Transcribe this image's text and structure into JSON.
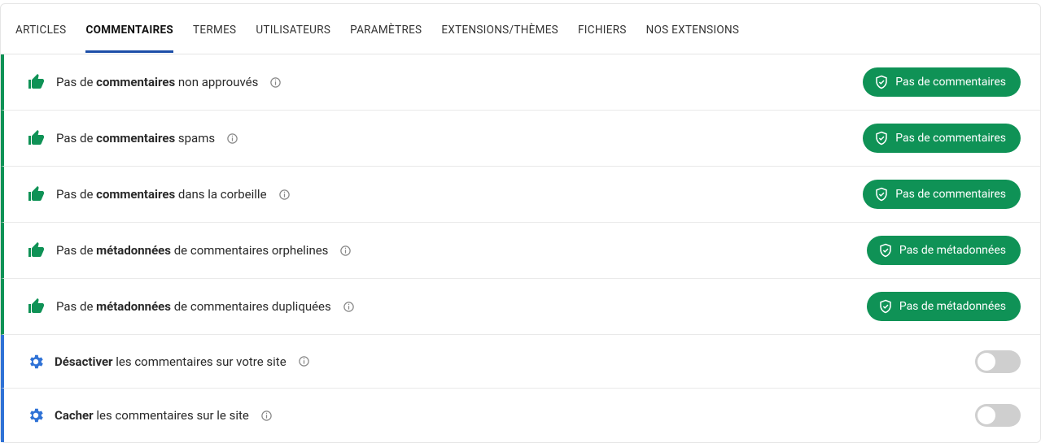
{
  "tabs": {
    "articles": "Articles",
    "commentaires": "Commentaires",
    "termes": "Termes",
    "utilisateurs": "Utilisateurs",
    "parametres": "Paramètres",
    "extensions": "Extensions/Thèmes",
    "fichiers": "Fichiers",
    "nos_extensions": "Nos extensions",
    "active": "commentaires"
  },
  "rows": {
    "unapproved": {
      "pre": "Pas de ",
      "bold": "commentaires",
      "post": " non approuvés"
    },
    "spam": {
      "pre": "Pas de ",
      "bold": "commentaires",
      "post": " spams"
    },
    "trash": {
      "pre": "Pas de ",
      "bold": "commentaires",
      "post": " dans la corbeille"
    },
    "meta_orphan": {
      "pre": "Pas de ",
      "bold": "métadonnées",
      "post": " de commentaires orphelines"
    },
    "meta_dup": {
      "pre": "Pas de ",
      "bold": "métadonnées",
      "post": " de commentaires dupliquées"
    },
    "disable": {
      "bold": "Désactiver",
      "post": " les commentaires sur votre site"
    },
    "hide": {
      "bold": "Cacher",
      "post": " les commentaires sur le site"
    }
  },
  "pill": {
    "comments": "Pas de commentaires",
    "metadata": "Pas de métadonnées"
  },
  "toggles": {
    "disable": false,
    "hide": false
  }
}
